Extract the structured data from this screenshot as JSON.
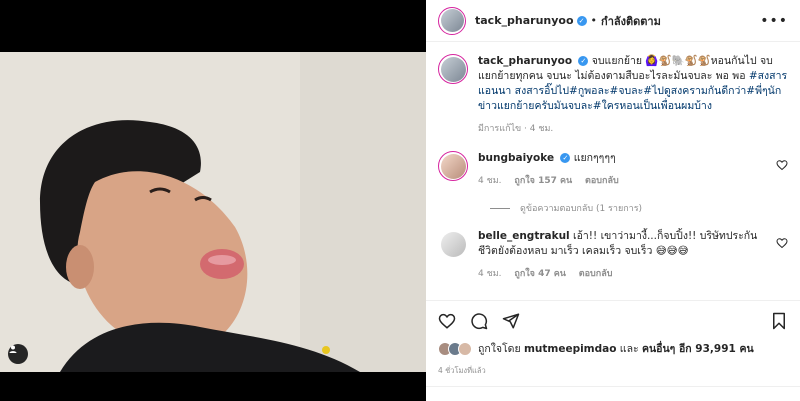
{
  "header": {
    "username": "tack_pharunyoo",
    "separator": "•",
    "follow_label": "กำลังติดตาม",
    "more_label": "•••"
  },
  "caption": {
    "username": "tack_pharunyoo",
    "text": "จบแยกย้าย 🙆‍♀️🐒🐘🐒🐒หอนกันไป จบแยกย้ายทุกคน จบนะ ไม่ต้องตามสืบอะไรละมันจบละ พอ พอ",
    "hashtags": "#สงสารแอนนา สงสารอิ๊ปไป#กูพอละ#จบละ#ไปดูสงครามกันดีกว่า#พี่ๆนักข่าวแยกย้ายครับมันจบละ#ใครหอนเป็นเพื่อนผมบ้าง",
    "meta": "มีการแก้ไข · 4 ชม."
  },
  "comments": [
    {
      "username": "bungbaiyoke",
      "text": "แยกๆๆๆๆ",
      "time": "4 ชม.",
      "likes": "ถูกใจ 157 คน",
      "reply": "ตอบกลับ",
      "view_replies": "ดูข้อความตอบกลับ (1 รายการ)"
    },
    {
      "username": "belle_engtrakul",
      "text": "เอ้า!! เขาว่ามางี้...ก็จบปิ้ง!! บริษัทประกันชีวิตยังต้องหลบ มาเร็ว เคลมเร็ว จบเร็ว 😅😅😅",
      "time": "4 ชม.",
      "likes": "ถูกใจ 47 คน",
      "reply": "ตอบกลับ"
    }
  ],
  "likes_row": {
    "prefix": "ถูกใจโดย",
    "user": "mutmeepimdao",
    "and": "และ",
    "others": "คนอื่นๆ อีก 93,991 คน"
  },
  "time_ago": "4 ชั่วโมงที่แล้ว",
  "colors": {
    "verified": "#3897f0",
    "hashtag": "#00376b",
    "story_ring": "#d6249f"
  },
  "icons": [
    "heart-icon",
    "comment-icon",
    "share-icon",
    "bookmark-icon",
    "tag-user-icon",
    "verified-icon",
    "more-icon"
  ]
}
